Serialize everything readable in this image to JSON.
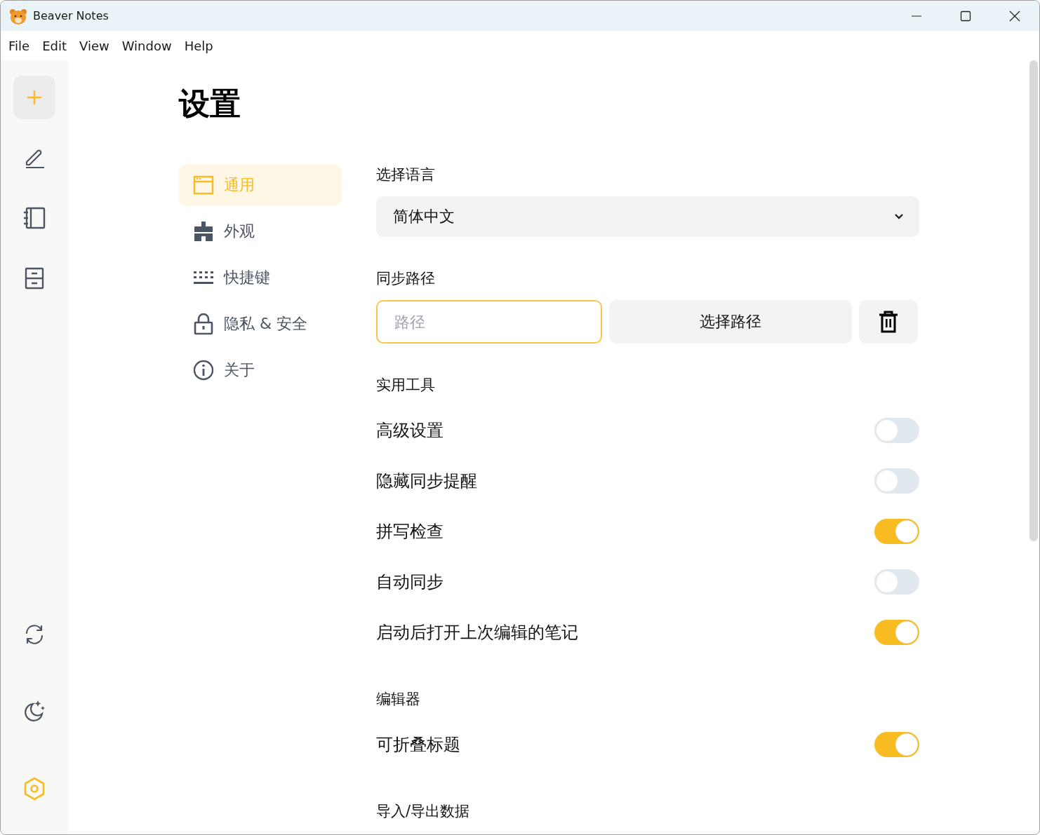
{
  "window": {
    "title": "Beaver Notes"
  },
  "menu": [
    "File",
    "Edit",
    "View",
    "Window",
    "Help"
  ],
  "sidebar": {
    "items": [
      {
        "kind": "edit",
        "selected": false
      },
      {
        "kind": "notebooks",
        "selected": false
      },
      {
        "kind": "archive",
        "selected": false
      },
      {
        "kind": "sync",
        "selected": false
      },
      {
        "kind": "theme",
        "selected": false
      },
      {
        "kind": "settings",
        "selected": true
      }
    ]
  },
  "page_title": "设置",
  "nav": [
    {
      "kind": "general",
      "label": "通用",
      "selected": true
    },
    {
      "kind": "appearance",
      "label": "外观",
      "selected": false
    },
    {
      "kind": "shortcuts",
      "label": "快捷键",
      "selected": false
    },
    {
      "kind": "privacy",
      "label": "隐私 & 安全",
      "selected": false
    },
    {
      "kind": "about",
      "label": "关于",
      "selected": false
    }
  ],
  "sections": [
    {
      "kind": "select",
      "title": "选择语言",
      "value": "简体中文"
    },
    {
      "kind": "path",
      "title": "同步路径",
      "placeholder": "路径",
      "button": "选择路径"
    },
    {
      "kind": "toggles",
      "title": "实用工具",
      "items": [
        {
          "label": "高级设置",
          "on": false
        },
        {
          "label": "隐藏同步提醒",
          "on": false
        },
        {
          "label": "拼写检查",
          "on": true
        },
        {
          "label": "自动同步",
          "on": false
        },
        {
          "label": "启动后打开上次编辑的笔记",
          "on": true
        }
      ]
    },
    {
      "kind": "toggles",
      "title": "编辑器",
      "items": [
        {
          "label": "可折叠标题",
          "on": true
        }
      ]
    },
    {
      "kind": "heading",
      "title": "导入/导出数据"
    }
  ]
}
